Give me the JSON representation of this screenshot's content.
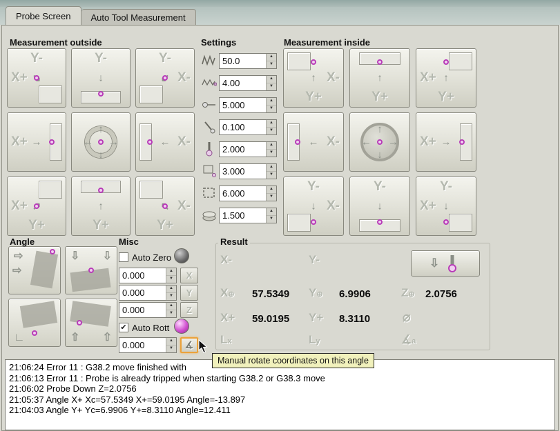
{
  "window": {
    "top_tabs": [
      {
        "label": "Probe Screen"
      },
      {
        "label": "Auto Tool Measurement"
      }
    ]
  },
  "outside": {
    "title": "Measurement outside",
    "buttons": [
      {
        "name": "outside-corner-x-plus-y-minus",
        "texts": [
          [
            "Y-",
            "t"
          ],
          [
            "X+",
            "ml"
          ]
        ],
        "arrows": [
          [
            "↘",
            "c"
          ]
        ],
        "rect": "br",
        "dot": "c"
      },
      {
        "name": "outside-edge-y-minus",
        "texts": [
          [
            "Y-",
            "t"
          ]
        ],
        "arrows": [
          [
            "↓",
            "c"
          ]
        ],
        "rect": "b",
        "dot": "cb"
      },
      {
        "name": "outside-corner-x-minus-y-minus",
        "texts": [
          [
            "Y-",
            "t"
          ],
          [
            "X-",
            "mr"
          ]
        ],
        "arrows": [
          [
            "↙",
            "c"
          ]
        ],
        "rect": "bl",
        "dot": "c"
      },
      {
        "name": "outside-edge-x-plus",
        "texts": [
          [
            "X+",
            "ml"
          ]
        ],
        "arrows": [
          [
            "→",
            "c"
          ]
        ],
        "rect": "r",
        "dot": "cr"
      },
      {
        "name": "outside-center-xy",
        "circle": "ring",
        "arrows": [
          [
            "↑",
            "ct"
          ],
          [
            "↓",
            "cb"
          ],
          [
            "←",
            "cl"
          ],
          [
            "→",
            "cr"
          ]
        ],
        "dot": "c"
      },
      {
        "name": "outside-edge-x-minus",
        "texts": [
          [
            "X-",
            "mr"
          ]
        ],
        "arrows": [
          [
            "←",
            "c"
          ]
        ],
        "rect": "l",
        "dot": "cl"
      },
      {
        "name": "outside-corner-x-plus-y-plus",
        "texts": [
          [
            "X+",
            "ml"
          ],
          [
            "Y+",
            "b"
          ]
        ],
        "arrows": [
          [
            "↗",
            "c"
          ]
        ],
        "rect": "tr",
        "dot": "c"
      },
      {
        "name": "outside-edge-y-plus",
        "texts": [
          [
            "Y+",
            "b"
          ]
        ],
        "arrows": [
          [
            "↑",
            "c"
          ]
        ],
        "rect": "t",
        "dot": "ct"
      },
      {
        "name": "outside-corner-x-minus-y-plus",
        "texts": [
          [
            "X-",
            "mr"
          ],
          [
            "Y+",
            "b"
          ]
        ],
        "arrows": [
          [
            "↖",
            "c"
          ]
        ],
        "rect": "tl",
        "dot": "c"
      }
    ]
  },
  "settings": {
    "title": "Settings",
    "rows": [
      {
        "icon": "search-feed-zigzag-icon",
        "value": "50.0"
      },
      {
        "icon": "probe-feed-zigzag-icon",
        "value": "4.00"
      },
      {
        "icon": "probe-max-distance-icon",
        "value": "5.000"
      },
      {
        "icon": "probe-latch-distance-icon",
        "value": "0.100"
      },
      {
        "icon": "probe-tip-diameter-icon",
        "value": "2.000"
      },
      {
        "icon": "xy-clearance-icon",
        "value": "3.000"
      },
      {
        "icon": "z-clearance-icon",
        "value": "6.000"
      },
      {
        "icon": "workpiece-height-icon",
        "value": "1.500"
      }
    ]
  },
  "inside": {
    "title": "Measurement inside",
    "buttons": [
      {
        "name": "inside-corner-x-minus-y-plus",
        "texts": [
          [
            "X-",
            "mr"
          ],
          [
            "Y+",
            "b"
          ]
        ],
        "arrows": [
          [
            "↑",
            "c"
          ]
        ],
        "rect": "tl",
        "dot": "ct"
      },
      {
        "name": "inside-edge-y-plus",
        "texts": [
          [
            "Y+",
            "b"
          ]
        ],
        "arrows": [
          [
            "↑",
            "c"
          ]
        ],
        "rect": "t",
        "dot": "ct"
      },
      {
        "name": "inside-corner-x-plus-y-plus",
        "texts": [
          [
            "X+",
            "ml"
          ],
          [
            "Y+",
            "b"
          ]
        ],
        "arrows": [
          [
            "↑",
            "c"
          ]
        ],
        "rect": "tr",
        "dot": "ct"
      },
      {
        "name": "inside-edge-x-minus",
        "texts": [
          [
            "X-",
            "mr"
          ]
        ],
        "arrows": [
          [
            "←",
            "c"
          ]
        ],
        "rect": "l",
        "dot": "cl"
      },
      {
        "name": "inside-hole-center",
        "circle": "hole",
        "arrows": [
          [
            "↑",
            "ct"
          ],
          [
            "↓",
            "cb"
          ],
          [
            "←",
            "cl"
          ],
          [
            "→",
            "cr"
          ]
        ],
        "dot": "c"
      },
      {
        "name": "inside-edge-x-plus",
        "texts": [
          [
            "X+",
            "ml"
          ]
        ],
        "arrows": [
          [
            "→",
            "c"
          ]
        ],
        "rect": "r",
        "dot": "cr"
      },
      {
        "name": "inside-corner-x-minus-y-minus",
        "texts": [
          [
            "X-",
            "mr"
          ],
          [
            "Y-",
            "t"
          ]
        ],
        "arrows": [
          [
            "↓",
            "c"
          ]
        ],
        "rect": "bl",
        "dot": "cb"
      },
      {
        "name": "inside-edge-y-minus",
        "texts": [
          [
            "Y-",
            "t"
          ]
        ],
        "arrows": [
          [
            "↓",
            "c"
          ]
        ],
        "rect": "b",
        "dot": "cb"
      },
      {
        "name": "inside-corner-x-plus-y-minus",
        "texts": [
          [
            "X+",
            "ml"
          ],
          [
            "Y-",
            "t"
          ]
        ],
        "arrows": [
          [
            "↓",
            "c"
          ]
        ],
        "rect": "br",
        "dot": "cb"
      }
    ]
  },
  "angle": {
    "title": "Angle",
    "buttons": [
      {
        "name": "angle-probe-x-plus",
        "quad": "right",
        "arrows": [
          [
            "⇨",
            "tl"
          ],
          [
            "⇨",
            "ml"
          ]
        ],
        "dots": [
          "tr"
        ]
      },
      {
        "name": "angle-probe-y-minus",
        "quad": "bottom",
        "arrows": [
          [
            "⇩",
            "tl"
          ],
          [
            "⇩",
            "tr"
          ]
        ],
        "dots": [
          "c"
        ]
      },
      {
        "name": "angle-probe-x-minus",
        "quad": "topright",
        "arrows": [
          [
            "∟",
            "bl"
          ]
        ],
        "dots": [
          "cb"
        ]
      },
      {
        "name": "angle-probe-y-plus",
        "quad": "top",
        "arrows": [
          [
            "⇧",
            "bl"
          ],
          [
            "⇧",
            "br"
          ]
        ],
        "dots": [
          "cl"
        ]
      }
    ]
  },
  "misc": {
    "title": "Misc",
    "auto_zero_label": "Auto Zero",
    "auto_zero_glyph": "",
    "auto_rott_label": "Auto Rott",
    "auto_rott_glyph": "✔",
    "spins": [
      {
        "value": "0.000",
        "button": "X"
      },
      {
        "value": "0.000",
        "button": "Y"
      },
      {
        "value": "0.000",
        "button": "Z"
      },
      {
        "value": "0.000",
        "button": "rotate"
      }
    ]
  },
  "result": {
    "title": "Result",
    "xm": "X-",
    "ym": "Y-",
    "xc_main": "X",
    "xc_sub": "⊕",
    "xc_value": "57.5349",
    "yc_main": "Y",
    "yc_sub": "⊕",
    "yc_value": "6.9906",
    "zc_main": "Z",
    "zc_sub": "⊕",
    "zc_value": "2.0756",
    "xp": "X+",
    "xp_value": "59.0195",
    "yp": "Y+",
    "yp_value": "8.3110",
    "diameter_symbol": "⌀",
    "lx_main": "L",
    "lx_sub": "x",
    "ly_main": "L",
    "ly_sub": "y",
    "angle_main": "∡",
    "angle_sub": "a"
  },
  "tooltip": {
    "text": "Manual rotate coordinates on this angle"
  },
  "log": {
    "lines": [
      "21:06:24  Error 11 : G38.2 move finished with",
      "21:06:13  Error 11 : Probe is already tripped when starting G38.2 or G38.3 move",
      "21:06:02  Probe Down Z=2.0756",
      "21:05:37  Angle X+  Xc=57.5349 X+=59.0195 Angle=-13.897",
      "21:04:03  Angle Y+  Yc=6.9906 Y+=8.3110 Angle=12.411"
    ]
  }
}
